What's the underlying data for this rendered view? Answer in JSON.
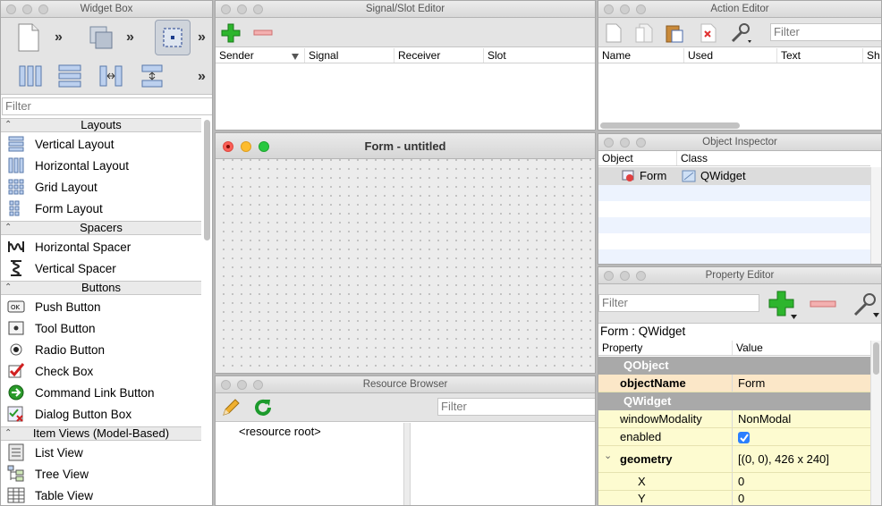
{
  "widget_box": {
    "title": "Widget Box",
    "filter_placeholder": "Filter",
    "categories": [
      {
        "label": "Layouts",
        "items": [
          "Vertical Layout",
          "Horizontal Layout",
          "Grid Layout",
          "Form Layout"
        ]
      },
      {
        "label": "Spacers",
        "items": [
          "Horizontal Spacer",
          "Vertical Spacer"
        ]
      },
      {
        "label": "Buttons",
        "items": [
          "Push Button",
          "Tool Button",
          "Radio Button",
          "Check Box",
          "Command Link Button",
          "Dialog Button Box"
        ]
      },
      {
        "label": "Item Views (Model-Based)",
        "items": [
          "List View",
          "Tree View",
          "Table View"
        ]
      }
    ]
  },
  "signal_slot": {
    "title": "Signal/Slot Editor",
    "columns": [
      "Sender",
      "Signal",
      "Receiver",
      "Slot"
    ]
  },
  "form": {
    "title": "Form - untitled"
  },
  "resource_browser": {
    "title": "Resource Browser",
    "filter_placeholder": "Filter",
    "root": "<resource root>"
  },
  "action_editor": {
    "title": "Action Editor",
    "filter_placeholder": "Filter",
    "columns": [
      "Name",
      "Used",
      "Text",
      "Sh"
    ]
  },
  "object_inspector": {
    "title": "Object Inspector",
    "columns": [
      "Object",
      "Class"
    ],
    "rows": [
      {
        "object": "Form",
        "class": "QWidget"
      }
    ]
  },
  "property_editor": {
    "title": "Property Editor",
    "filter_placeholder": "Filter",
    "context": "Form : QWidget",
    "columns": [
      "Property",
      "Value"
    ],
    "rows": [
      {
        "kind": "group",
        "name": "QObject"
      },
      {
        "kind": "prop",
        "name": "objectName",
        "value": "Form",
        "bold": true
      },
      {
        "kind": "group",
        "name": "QWidget"
      },
      {
        "kind": "prop",
        "name": "windowModality",
        "value": "NonModal"
      },
      {
        "kind": "prop",
        "name": "enabled",
        "value": "",
        "checkbox": true
      },
      {
        "kind": "prop",
        "name": "geometry",
        "value": "[(0, 0), 426 x 240]",
        "bold": true,
        "expanded": true
      },
      {
        "kind": "sub",
        "name": "X",
        "value": "0"
      },
      {
        "kind": "sub",
        "name": "Y",
        "value": "0"
      }
    ]
  },
  "colors": {
    "group_row": "#a9a9a9",
    "highlight_row": "#fbe7c8",
    "prop_row": "#fdfbd0",
    "selected_row": "#dcdcdc",
    "alt_row": "#edf3fe"
  }
}
